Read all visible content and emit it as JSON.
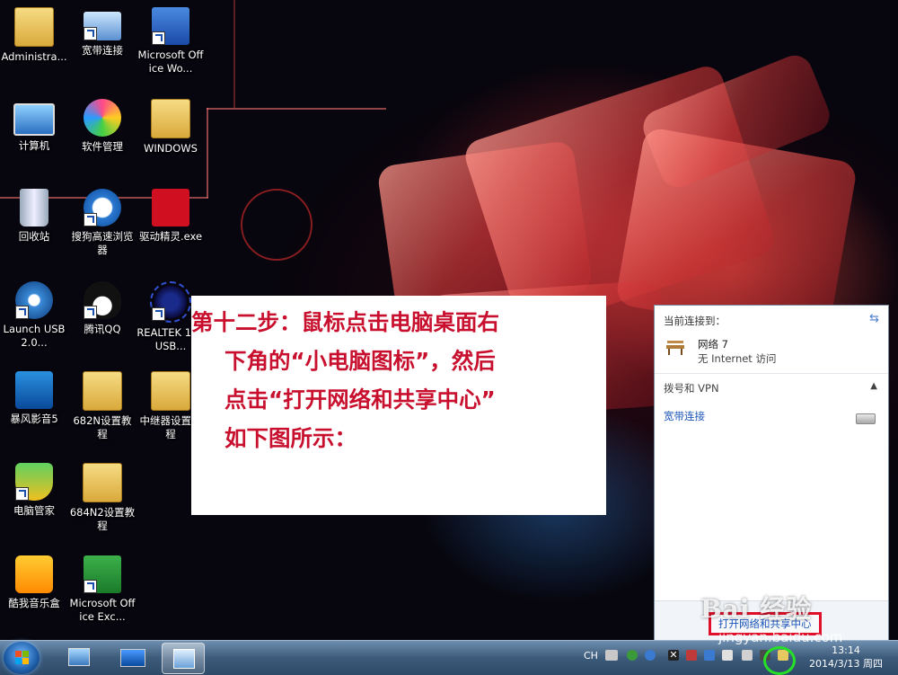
{
  "desktop_icons": [
    {
      "label": "Administra..."
    },
    {
      "label": "宽带连接"
    },
    {
      "label": "Microsoft Office Wo..."
    },
    {
      "label": "计算机"
    },
    {
      "label": "软件管理"
    },
    {
      "label": "WINDOWS"
    },
    {
      "label": "回收站"
    },
    {
      "label": "搜狗高速浏览器"
    },
    {
      "label": "驱动精灵.exe"
    },
    {
      "label": "Launch USB2.0..."
    },
    {
      "label": "腾讯QQ"
    },
    {
      "label": "REALTEK 11n USB..."
    },
    {
      "label": "暴风影音5"
    },
    {
      "label": "682N设置教程"
    },
    {
      "label": "中继器设置教程"
    },
    {
      "label": "电脑管家"
    },
    {
      "label": "684N2设置教程"
    },
    {
      "label": "酷我音乐盒"
    },
    {
      "label": "Microsoft Office Exc..."
    }
  ],
  "callout": {
    "line1": "第十二步：鼠标点击电脑桌面右",
    "line2": "下角的“小电脑图标”，然后",
    "line3": "点击“打开网络和共享中心”",
    "line4": "如下图所示："
  },
  "network_panel": {
    "header": "当前连接到：",
    "network_name": "网络  7",
    "network_status": "无 Internet 访问",
    "section_label": "拨号和 VPN",
    "connection_label": "宽带连接",
    "open_center_label": "打开网络和共享中心"
  },
  "watermark": {
    "brand": "Bai 经验",
    "url": "jingyan.baidu.com"
  },
  "tray": {
    "language": "CH",
    "time": "13:14",
    "date": "2014/3/13 周四"
  },
  "colors": {
    "callout_text": "#c8102e",
    "highlight_box": "#e0102a",
    "tray_ring": "#26e026",
    "link": "#1a55b8"
  }
}
